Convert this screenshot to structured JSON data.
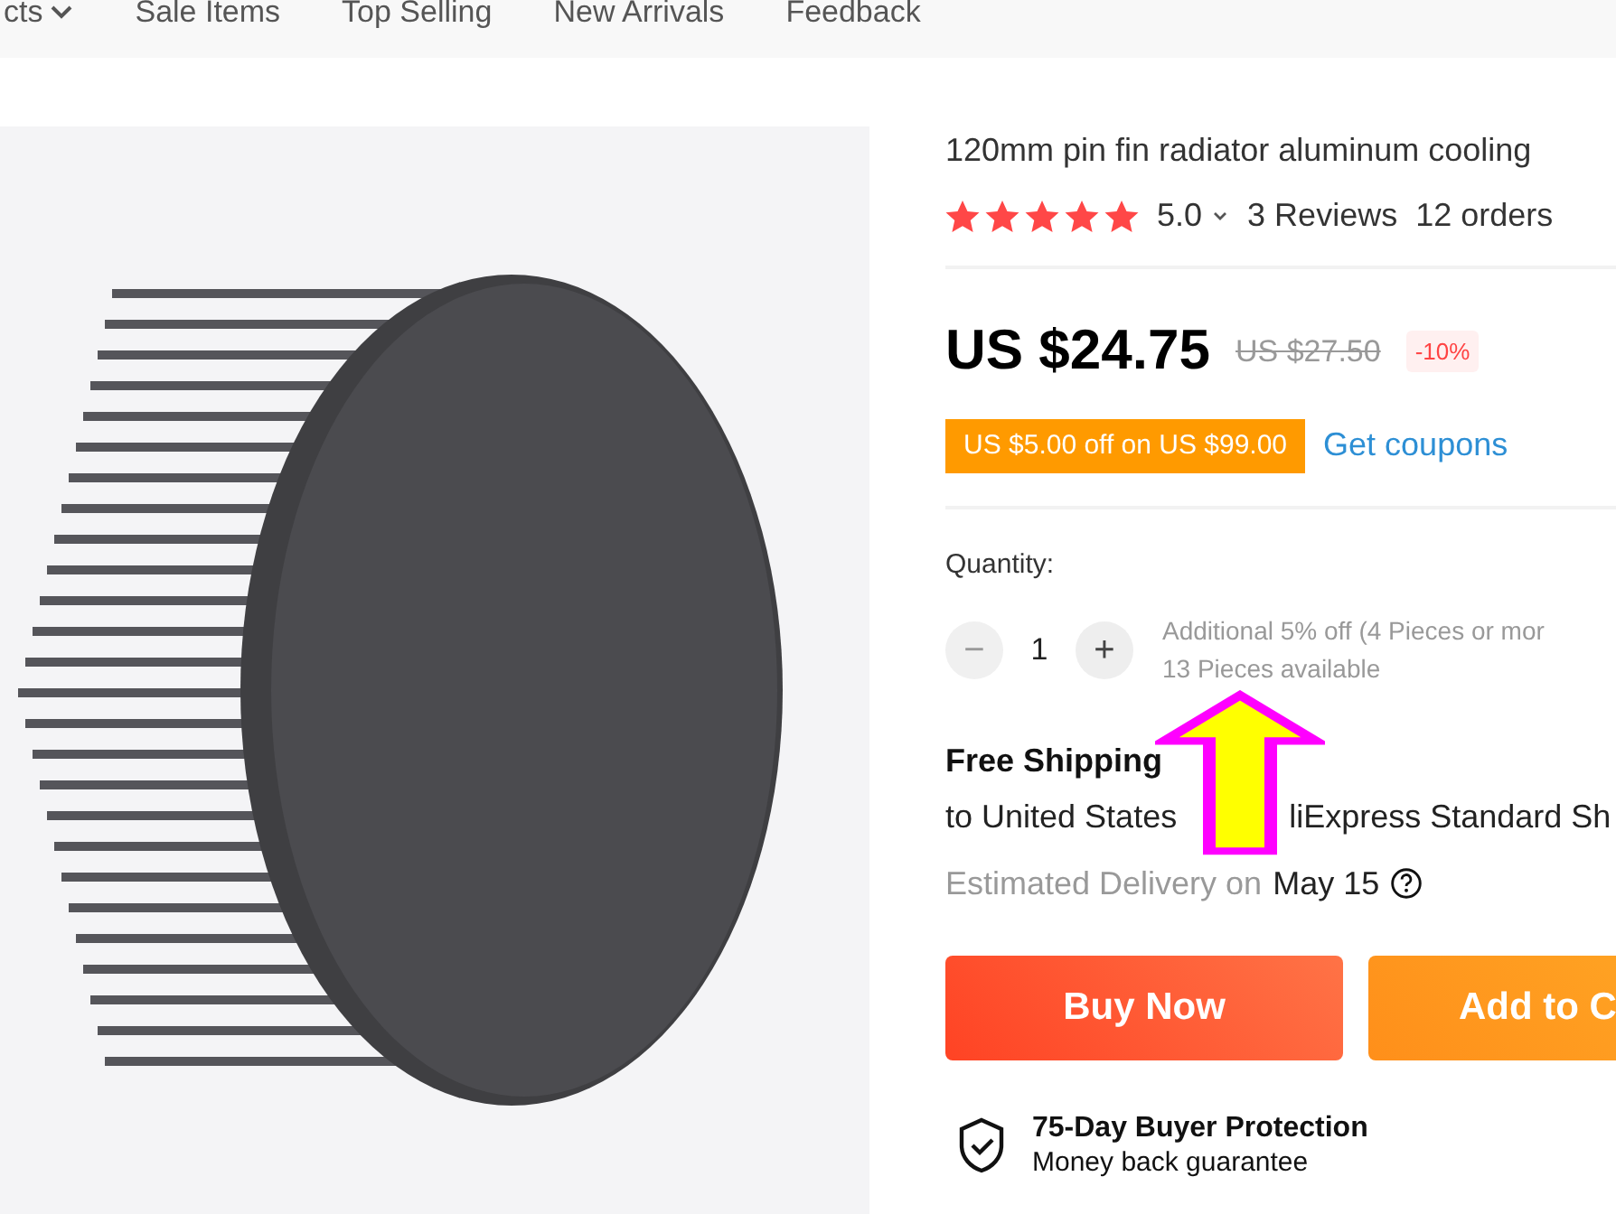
{
  "nav": {
    "items": [
      {
        "label": "cts",
        "dropdown": true
      },
      {
        "label": "Sale Items",
        "dropdown": false
      },
      {
        "label": "Top Selling",
        "dropdown": false
      },
      {
        "label": "New Arrivals",
        "dropdown": false
      },
      {
        "label": "Feedback",
        "dropdown": false
      }
    ]
  },
  "product": {
    "title": "120mm pin fin radiator aluminum cooling",
    "stars": 5,
    "rating": "5.0",
    "reviews": "3 Reviews",
    "orders": "12 orders",
    "price": "US $24.75",
    "old_price": "US $27.50",
    "discount": "-10%",
    "coupon": "US $5.00 off on US $99.00",
    "coupon_link": "Get coupons",
    "quantity_label": "Quantity:",
    "quantity": "1",
    "minus": "−",
    "plus": "+",
    "minus_disabled": true,
    "bulk_note": "Additional 5% off (4 Pieces or mor",
    "available": "13 Pieces available",
    "shipping_title": "Free Shipping",
    "shipping_to": "to United States",
    "shipping_via": "liExpress Standard Sh",
    "delivery_label": "Estimated Delivery on",
    "delivery_date": "May 15",
    "buttons": [
      {
        "label": "Buy Now",
        "kind": "buy"
      },
      {
        "label": "Add to C",
        "kind": "cart"
      }
    ],
    "protection_title": "75-Day Buyer Protection",
    "protection_text": "Money back guarantee"
  }
}
